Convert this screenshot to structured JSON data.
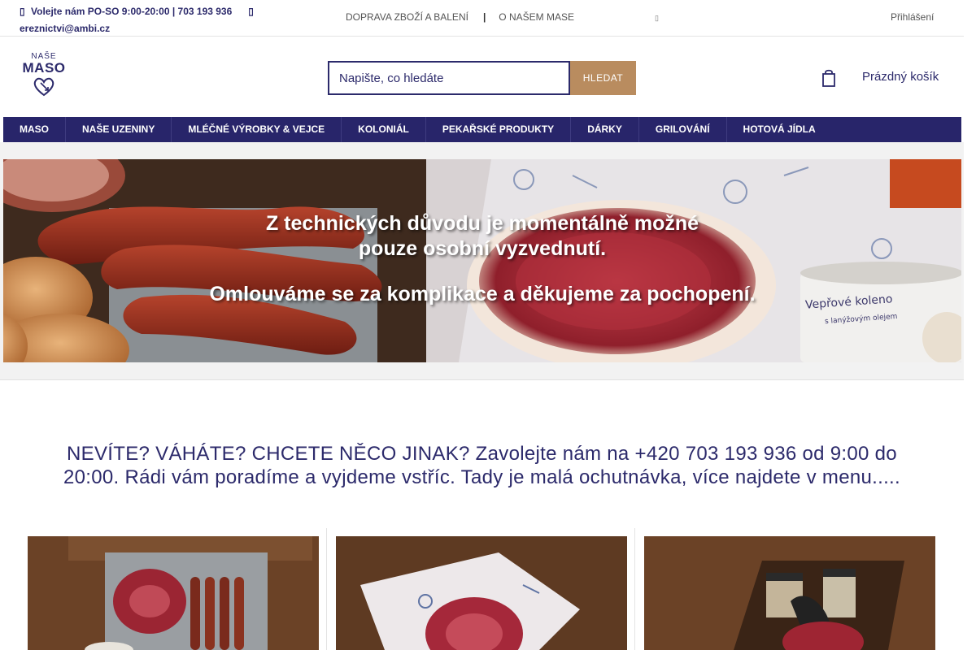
{
  "topbar": {
    "phone_line": "Volejte nám PO-SO 9:00-20:00 | 703 193 936",
    "email": "ereznictvi@ambi.cz",
    "links": [
      "DOPRAVA ZBOŽÍ A BALENÍ",
      "O NAŠEM MASE"
    ],
    "separator": "|",
    "login": "Přihlášení",
    "icons": [
      "phone-icon",
      "mail-icon",
      "dropdown-icon"
    ]
  },
  "logo": {
    "line1": "NAŠE",
    "line2": "MASO"
  },
  "search": {
    "placeholder": "Napište, co hledáte",
    "button": "HLEDAT"
  },
  "cart": {
    "label": "Prázdný košík",
    "icon": "cart-icon"
  },
  "nav": {
    "items": [
      "MASO",
      "NAŠE UZENINY",
      "MLÉČNÉ VÝROBKY & VEJCE",
      "KOLONIÁL",
      "PEKAŘSKÉ PRODUKTY",
      "DÁRKY",
      "GRILOVÁNÍ",
      "HOTOVÁ JÍDLA"
    ]
  },
  "banner": {
    "line1": "Z technických důvodu je momentálně možné",
    "line2": "pouze osobní vyzvednutí.",
    "line3": "Omlouváme se za komplikace a děkujeme za pochopení.",
    "can_label": "Vepřové koleno",
    "can_sublabel": "s lanýžovým olejem"
  },
  "promo": {
    "text": "NEVÍTE? VÁHÁTE? CHCETE NĚCO JINAK? Zavolejte nám na +420 703 193 936 od 9:00 do 20:00. Rádi vám poradíme a vyjdeme vstříc. Tady je malá ochutnávka, více najdete v menu....."
  },
  "colors": {
    "brand": "#28256a",
    "accent": "#b98c5f"
  }
}
